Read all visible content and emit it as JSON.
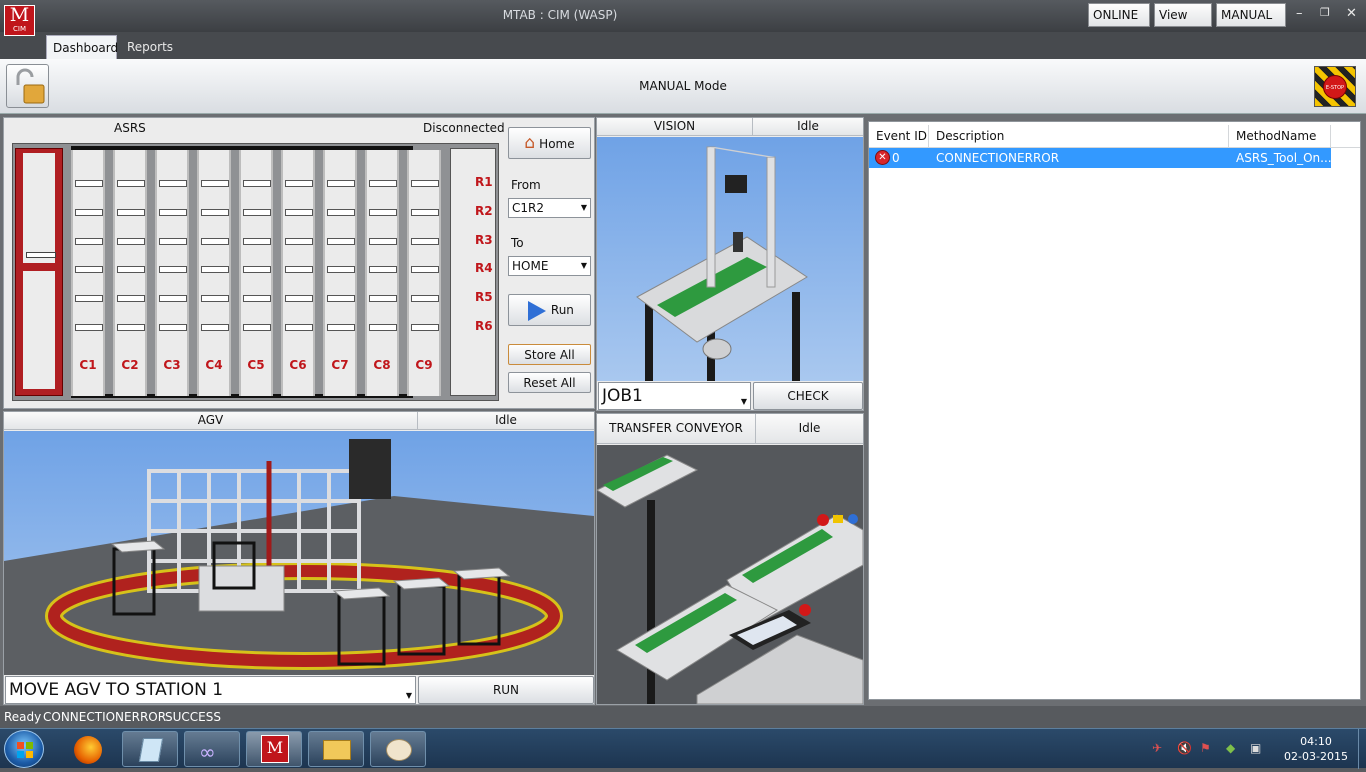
{
  "app": {
    "logo_text": "M",
    "logo_sub": "CIM",
    "title": "MTAB : CIM (WASP)",
    "connection_dropdown": "ONLINE",
    "view_sim_button": "View SIM",
    "mode_dropdown": "MANUAL"
  },
  "tabs": [
    "Dashboard",
    "Reports"
  ],
  "ribbon": {
    "mode_text": "MANUAL Mode",
    "estop_label": "E-STOP"
  },
  "asrs": {
    "title": "ASRS",
    "status": "Disconnected",
    "columns": [
      "C1",
      "C2",
      "C3",
      "C4",
      "C5",
      "C6",
      "C7",
      "C8",
      "C9"
    ],
    "rows": [
      "R1",
      "R2",
      "R3",
      "R4",
      "R5",
      "R6"
    ],
    "home_button": "Home",
    "from_label": "From",
    "from_value": "C1R2",
    "to_label": "To",
    "to_value": "HOME",
    "run_button": "Run",
    "store_all_button": "Store All",
    "reset_all_button": "Reset All"
  },
  "vision": {
    "title": "VISION",
    "status": "Idle",
    "job_value": "JOB1",
    "check_button": "CHECK"
  },
  "transfer": {
    "title": "TRANSFER CONVEYOR",
    "status": "Idle"
  },
  "agv": {
    "title": "AGV",
    "status": "Idle",
    "command_value": "MOVE AGV TO STATION 1",
    "run_button": "RUN"
  },
  "events": {
    "columns": [
      "Event ID",
      "Description",
      "MethodName"
    ],
    "rows": [
      {
        "id": "0",
        "description": "CONNECTIONERROR",
        "method": "ASRS_Tool_On..."
      }
    ]
  },
  "statusbar": {
    "ready": "Ready",
    "error": "CONNECTIONERROR",
    "result": "SUCCESS"
  },
  "taskbar": {
    "time": "04:10",
    "date": "02-03-2015"
  },
  "colors": {
    "accent_red": "#c0161b",
    "selection_blue": "#3399ff"
  }
}
